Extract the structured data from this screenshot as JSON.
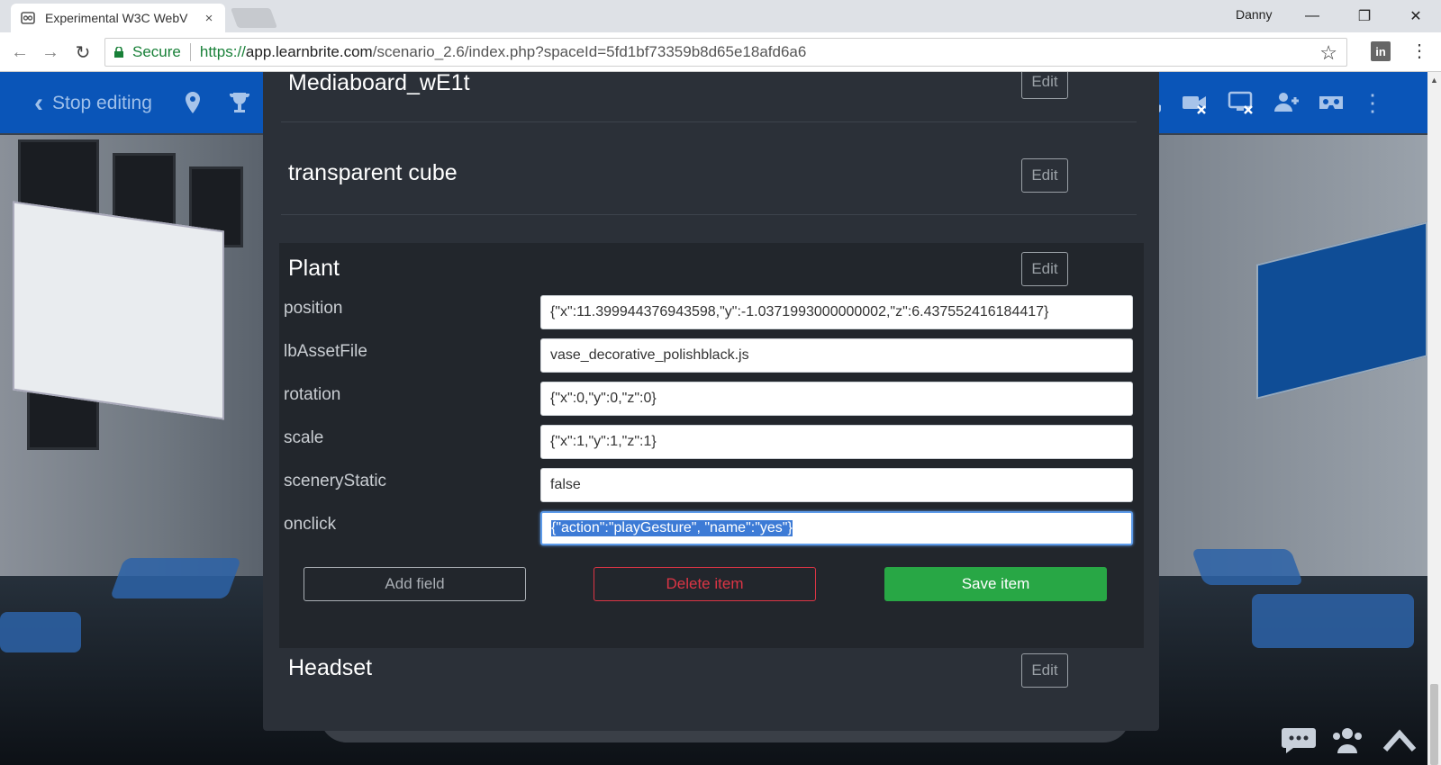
{
  "browser": {
    "tab_title": "Experimental W3C WebV",
    "tab_close": "×",
    "profile_name": "Danny",
    "minimize": "—",
    "restore": "❐",
    "close": "✕",
    "secure_label": "Secure",
    "url_scheme": "https://",
    "url_host": "app.learnbrite.com",
    "url_path": "/scenario_2.6/index.php?spaceId=5fd1bf73359b8d65e18afd6a6",
    "back": "←",
    "forward": "→",
    "reload": "↻",
    "bookmark_star": "☆",
    "extension_label": "in",
    "menu": "⋮"
  },
  "appbar": {
    "stop_editing_label": "Stop editing"
  },
  "editor": {
    "items": [
      {
        "name": "Mediaboard_wE1t",
        "edit_label": "Edit"
      },
      {
        "name": "transparent cube",
        "edit_label": "Edit"
      },
      {
        "name": "Plant",
        "edit_label": "Edit"
      },
      {
        "name": "Headset",
        "edit_label": "Edit"
      }
    ],
    "fields": [
      {
        "label": "position",
        "value": "{\"x\":11.399944376943598,\"y\":-1.0371993000000002,\"z\":6.437552416184417}"
      },
      {
        "label": "lbAssetFile",
        "value": "vase_decorative_polishblack.js"
      },
      {
        "label": "rotation",
        "value": "{\"x\":0,\"y\":0,\"z\":0}"
      },
      {
        "label": "scale",
        "value": "{\"x\":1,\"y\":1,\"z\":1}"
      },
      {
        "label": "sceneryStatic",
        "value": "false"
      },
      {
        "label": "onclick",
        "value": "{\"action\":\"playGesture\", \"name\":\"yes\"}"
      }
    ],
    "buttons": {
      "add_field": "Add field",
      "delete_item": "Delete item",
      "save_item": "Save item"
    }
  },
  "colors": {
    "appbar_blue": "#0a55b8",
    "panel_bg": "#2b3038",
    "save_green": "#28a745",
    "delete_red": "#dc3545"
  }
}
